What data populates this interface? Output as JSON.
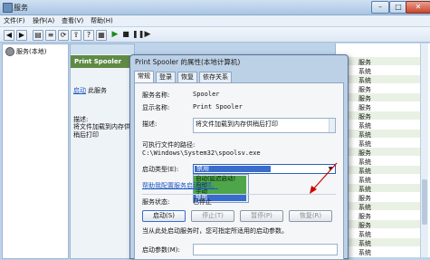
{
  "window": {
    "title": "服务",
    "icon": "services-icon"
  },
  "menu": [
    "文件(F)",
    "操作(A)",
    "查看(V)",
    "帮助(H)"
  ],
  "tree": {
    "label": "服务(本地)"
  },
  "desc": {
    "header_service": "Print Spooler",
    "start_link": "启动",
    "start_rest": "此服务",
    "desc_label": "描述:",
    "desc_text": "将文件加载到内存供稍后打印"
  },
  "list_rows": [
    "服务",
    "系统",
    "系统",
    "服务",
    "服务",
    "服务",
    "服务",
    "系统",
    "系统",
    "系统",
    "服务",
    "系统",
    "系统",
    "系统",
    "系统",
    "服务",
    "系统",
    "服务",
    "服务",
    "系统",
    "系统",
    "系统"
  ],
  "dialog": {
    "title": "Print Spooler 的属性(本地计算机)",
    "tabs": [
      "常规",
      "登录",
      "恢复",
      "依存关系"
    ],
    "service_name_label": "服务名称:",
    "service_name": "Spooler",
    "display_name_label": "显示名称:",
    "display_name": "Print Spooler",
    "description_label": "描述:",
    "description": "将文件加载到内存供稍后打印",
    "path_label": "可执行文件的路径:",
    "path": "C:\\Windows\\System32\\spoolsv.exe",
    "startup_type_label": "启动类型(E):",
    "startup_type_selected": "禁用",
    "startup_options": [
      "自动(延迟启动)",
      "自动",
      "手动",
      "禁用"
    ],
    "help_link": "帮助我配置服务启动选项。",
    "status_label": "服务状态:",
    "status_value": "已停止",
    "buttons": {
      "start": "启动(S)",
      "stop": "停止(T)",
      "pause": "暂停(P)",
      "resume": "恢复(R)"
    },
    "hint": "当从此处启动服务时，您可指定所适用的启动参数。",
    "param_label": "启动参数(M):"
  },
  "colors": {
    "accent": "#3a6ccd",
    "annotation": "#d10000",
    "green_highlight": "#4fa64a"
  }
}
